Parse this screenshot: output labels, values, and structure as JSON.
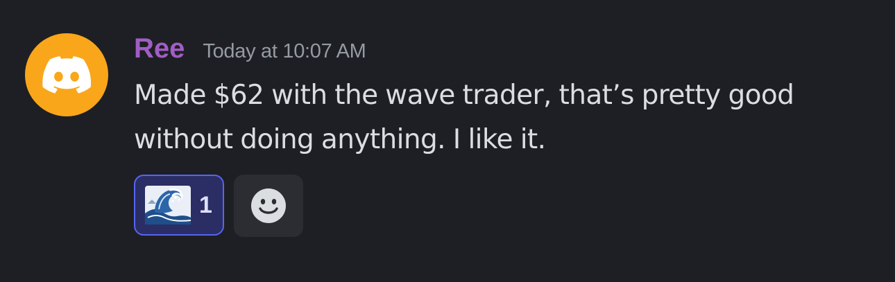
{
  "message": {
    "author": "Ree",
    "author_color": "#a05ec4",
    "avatar_color": "#faa61a",
    "avatar_icon": "discord-logo-icon",
    "timestamp": "Today at 10:07 AM",
    "content": "Made $62 with the wave trader, that’s pretty good without doing anything. I like it."
  },
  "reactions": [
    {
      "emoji": "wave-emoji",
      "count": "1",
      "selected": true
    }
  ],
  "add_reaction": {
    "icon": "smiley-icon"
  }
}
